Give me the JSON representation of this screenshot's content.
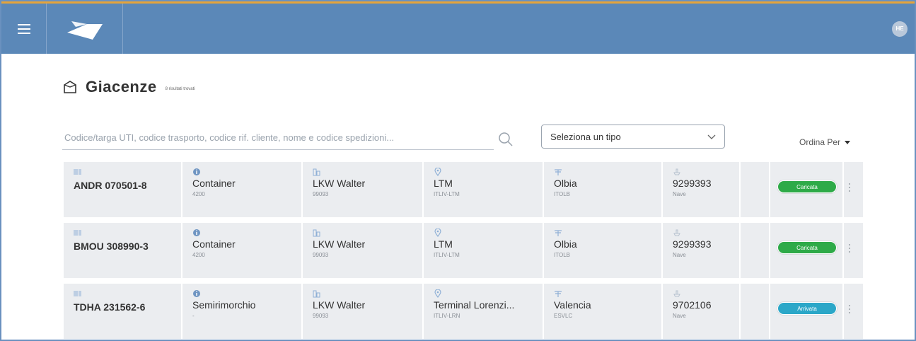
{
  "header": {
    "menu_icon": "hamburger-icon",
    "logo_icon": "bird-logo-icon",
    "user_initials": "HE"
  },
  "page": {
    "title": "Giacenze",
    "subtitle": "8 risultati trovati",
    "title_icon": "package-icon"
  },
  "filters": {
    "search_placeholder": "Codice/targa UTI, codice trasporto, codice rif. cliente, nome e codice spedizioni...",
    "type_select_value": "Seleziona un tipo",
    "sort_label": "Ordina Per"
  },
  "colors": {
    "header_bg": "#5b88b8",
    "header_accent": "#e5a43a",
    "status_caricata": "#2eaa48",
    "status_arrivata": "#2ba7c8"
  },
  "rows": [
    {
      "code": "ANDR 070501-8",
      "type": "Container",
      "type_sub": "4200",
      "carrier": "LKW Walter",
      "carrier_sub": "99093",
      "terminal": "LTM",
      "terminal_sub": "ITLIV-LTM",
      "port": "Olbia",
      "port_sub": "ITOLB",
      "ship": "9299393",
      "ship_sub": "Nave",
      "status": "Caricata",
      "status_color": "#2eaa48"
    },
    {
      "code": "BMOU 308990-3",
      "type": "Container",
      "type_sub": "4200",
      "carrier": "LKW Walter",
      "carrier_sub": "99093",
      "terminal": "LTM",
      "terminal_sub": "ITLIV-LTM",
      "port": "Olbia",
      "port_sub": "ITOLB",
      "ship": "9299393",
      "ship_sub": "Nave",
      "status": "Caricata",
      "status_color": "#2eaa48"
    },
    {
      "code": "TDHA 231562-6",
      "type": "Semirimorchio",
      "type_sub": "-",
      "carrier": "LKW Walter",
      "carrier_sub": "99093",
      "terminal": "Terminal Lorenzi...",
      "terminal_sub": "ITLIV-LRN",
      "port": "Valencia",
      "port_sub": "ESVLC",
      "ship": "9702106",
      "ship_sub": "Nave",
      "status": "Arrivata",
      "status_color": "#2ba7c8"
    }
  ]
}
